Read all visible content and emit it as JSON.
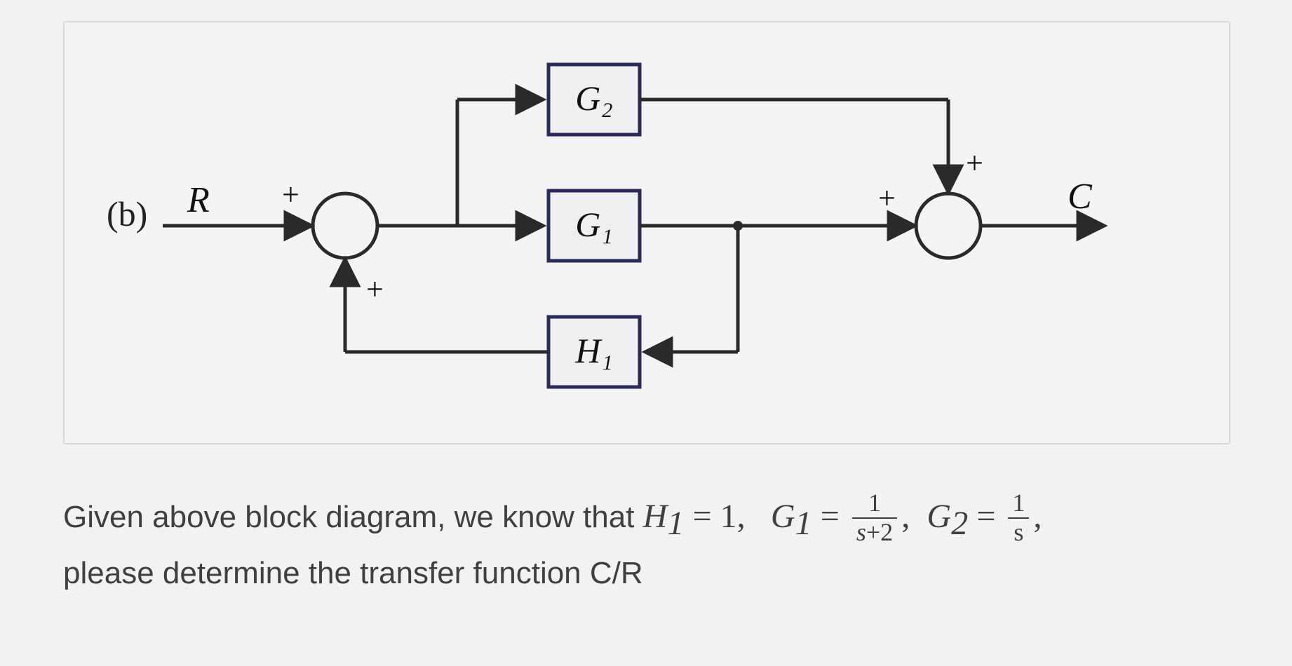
{
  "diagram": {
    "part_label": "(b)",
    "input_label": "R",
    "output_label": "C",
    "blocks": {
      "g2": "G₂",
      "g1": "G₁",
      "h1": "H₁"
    },
    "signs": {
      "sum1_top": "+",
      "sum1_bottom": "+",
      "sum2_left": "+",
      "sum2_top": "+"
    }
  },
  "question": {
    "line1_prefix": "Given above block diagram, we know that ",
    "h1_var": "H",
    "h1_sub": "1",
    "eq": " = ",
    "h1_val": "1",
    "g1_var": "G",
    "g1_sub": "1",
    "g1_num": "1",
    "g1_den_s": "s",
    "g1_den_rest": "+2",
    "g2_var": "G",
    "g2_sub": "2",
    "g2_num": "1",
    "g2_den": "s",
    "line2": "please determine the transfer function C/R"
  }
}
